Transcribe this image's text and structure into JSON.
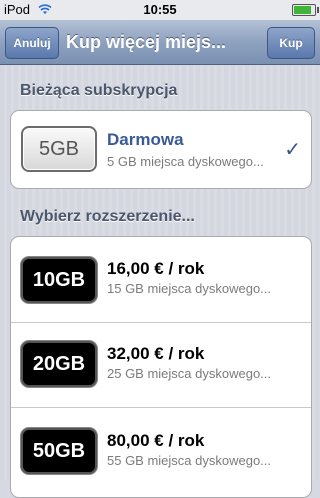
{
  "status_bar": {
    "carrier": "iPod",
    "time": "10:55",
    "battery_level": 0.85,
    "wifi_icon": "wifi-icon",
    "battery_icon": "battery-icon"
  },
  "nav": {
    "cancel_label": "Anuluj",
    "title": "Kup więcej miejs...",
    "buy_label": "Kup"
  },
  "current": {
    "header": "Bieżąca subskrypcja",
    "item": {
      "badge": "5GB",
      "title": "Darmowa",
      "subtitle": "5 GB miejsca dyskowego...",
      "check": "✓",
      "title_color": "#3a5a96"
    }
  },
  "upgrades": {
    "header": "Wybierz rozszerzenie...",
    "items": [
      {
        "badge": "10GB",
        "title": "16,00 € / rok",
        "subtitle": "15 GB miejsca dyskowego..."
      },
      {
        "badge": "20GB",
        "title": "32,00 € / rok",
        "subtitle": "25 GB miejsca dyskowego..."
      },
      {
        "badge": "50GB",
        "title": "80,00 € / rok",
        "subtitle": "55 GB miejsca dyskowego..."
      }
    ]
  }
}
